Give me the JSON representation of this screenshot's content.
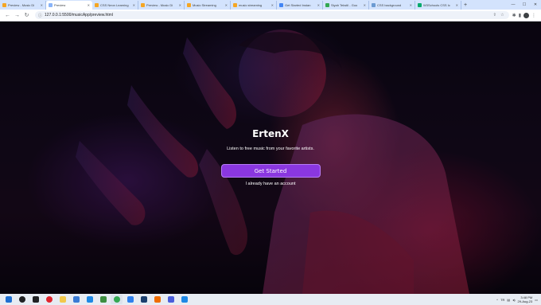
{
  "browser": {
    "tabs": [
      {
        "label": "Preview - Music Di",
        "color": "#f5a623",
        "active": false
      },
      {
        "label": "Preview",
        "color": "#8ab4f8",
        "active": true
      },
      {
        "label": "CSS Neon Learning",
        "color": "#f5a623",
        "active": false
      },
      {
        "label": "Preview - Music Di",
        "color": "#f5a623",
        "active": false
      },
      {
        "label": "Music Streaming",
        "color": "#f5a623",
        "active": false
      },
      {
        "label": "music streaming",
        "color": "#f5a623",
        "active": false
      },
      {
        "label": "Get Started Instan",
        "color": "#4285f4",
        "active": false
      },
      {
        "label": "Siyah Tekstil - Goo",
        "color": "#34a853",
        "active": false
      },
      {
        "label": "CSS background",
        "color": "#6c9bd2",
        "active": false
      },
      {
        "label": "W3Schools CSS Ic",
        "color": "#04aa6d",
        "active": false
      }
    ],
    "new_tab": "+",
    "url": "127.0.0.1:5500/musicApp/preview.html",
    "controls": {
      "minimize": "—",
      "maximize": "☐",
      "close": "✕"
    }
  },
  "hero": {
    "brand": "ErtenX",
    "tagline": "Listen to free music from your favorite artists.",
    "cta_label": "Get Started",
    "login_label": "I already have an account"
  },
  "colors": {
    "accent": "#8a37e0",
    "accent_border": "#b57cf5"
  },
  "taskbar": {
    "apps": [
      {
        "name": "windows-start",
        "color": "#1f6fd1"
      },
      {
        "name": "search",
        "color": "#202124"
      },
      {
        "name": "task-view",
        "color": "#202124"
      },
      {
        "name": "opera",
        "color": "#e0242e"
      },
      {
        "name": "file-explorer",
        "color": "#f2c84b"
      },
      {
        "name": "store",
        "color": "#3a7bd5"
      },
      {
        "name": "mail",
        "color": "#1e88e5"
      },
      {
        "name": "app-green",
        "color": "#3e8e41"
      },
      {
        "name": "chrome",
        "color": "#34a853"
      },
      {
        "name": "photos",
        "color": "#2f80ed"
      },
      {
        "name": "photoshop",
        "color": "#1c3f6e"
      },
      {
        "name": "app-orange",
        "color": "#ef6c00"
      },
      {
        "name": "app-blue",
        "color": "#4a5ddb"
      },
      {
        "name": "vscode",
        "color": "#1e88e5"
      }
    ],
    "tray": {
      "lang": "TR",
      "time": "3:48 PM",
      "date": "29-Aug-23"
    }
  }
}
